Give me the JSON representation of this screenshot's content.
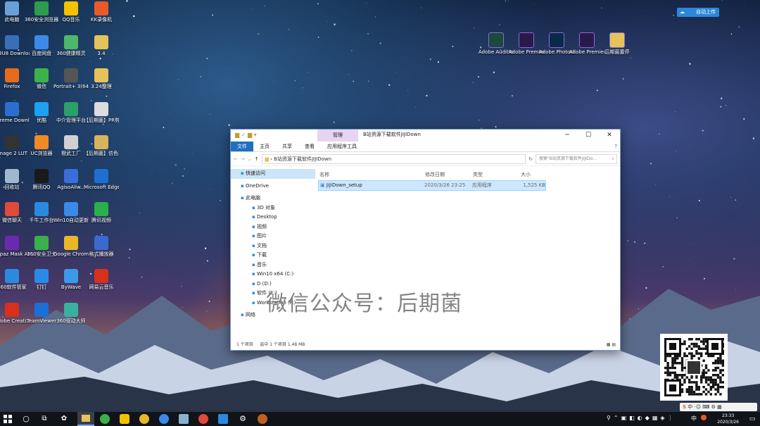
{
  "desktop_icons_left": [
    {
      "label": "此电脑",
      "icon": "computer-icon",
      "color": "#6aa0d8"
    },
    {
      "label": "360安全浏览器",
      "icon": "browser-360-icon",
      "color": "#2e9b4f"
    },
    {
      "label": "QQ音乐",
      "icon": "qq-music-icon",
      "color": "#f2c200"
    },
    {
      "label": "KK录像机",
      "icon": "kk-recorder-icon",
      "color": "#e85a2a"
    },
    {
      "label": "M3U8 Downloader",
      "icon": "m3u8-icon",
      "color": "#3a6fb8"
    },
    {
      "label": "百度网盘",
      "icon": "baidu-netdisk-icon",
      "color": "#3b8ae8"
    },
    {
      "label": "360健康精灵",
      "icon": "health-icon",
      "color": "#4db86a"
    },
    {
      "label": "3.4",
      "icon": "folder-icon",
      "color": "#e6c25a"
    },
    {
      "label": "Firefox",
      "icon": "firefox-icon",
      "color": "#e86a1c"
    },
    {
      "label": "微信",
      "icon": "wechat-icon",
      "color": "#3cb34a"
    },
    {
      "label": "Portrait+ 3(64 Bit)",
      "icon": "portrait-icon",
      "color": "#555555"
    },
    {
      "label": "3.24整理",
      "icon": "folder-icon",
      "color": "#e6c25a"
    },
    {
      "label": "Xtreme Downlo...",
      "icon": "xtreme-icon",
      "color": "#2a6fd0"
    },
    {
      "label": "优酷",
      "icon": "youku-icon",
      "color": "#1da1f2"
    },
    {
      "label": "中介管理平台",
      "icon": "platform-icon",
      "color": "#2aa06a"
    },
    {
      "label": "【后期菌】PR剪辑神...",
      "icon": "file-icon",
      "color": "#dddddd"
    },
    {
      "label": "Image 2 LUT",
      "icon": "image2lut-icon",
      "color": "#333333"
    },
    {
      "label": "UC浏览器",
      "icon": "uc-browser-icon",
      "color": "#f08a24"
    },
    {
      "label": "橙武工厂",
      "icon": "factory-icon",
      "color": "#d0d0d0"
    },
    {
      "label": "【后期菌】仿色神器软件...",
      "icon": "file-icon",
      "color": "#d8b45a"
    },
    {
      "label": "回收站",
      "icon": "recycle-bin-icon",
      "color": "#9fb8d0"
    },
    {
      "label": "腾讯QQ",
      "icon": "qq-icon",
      "color": "#1a1a1a"
    },
    {
      "label": "AgisoAliw...",
      "icon": "agiso-icon",
      "color": "#3a6fd8"
    },
    {
      "label": "Microsoft Edge",
      "icon": "edge-icon",
      "color": "#1e6fd0"
    },
    {
      "label": "微信聊天",
      "icon": "chat-icon",
      "color": "#e04a3a"
    },
    {
      "label": "千牛工作台",
      "icon": "qianniu-icon",
      "color": "#2a8ae0"
    },
    {
      "label": "Win10自动更新",
      "icon": "win10-update-icon",
      "color": "#3a8ae8"
    },
    {
      "label": "腾讯视频",
      "icon": "tencent-video-icon",
      "color": "#2ab04a"
    },
    {
      "label": "Topaz Mask AI",
      "icon": "topaz-icon",
      "color": "#6a2ab0"
    },
    {
      "label": "360安全卫士",
      "icon": "360-guard-icon",
      "color": "#3ab04a"
    },
    {
      "label": "Google Chrome",
      "icon": "chrome-icon",
      "color": "#e8b82a"
    },
    {
      "label": "格式播放器",
      "icon": "player-icon",
      "color": "#3a6ad0"
    },
    {
      "label": "360软件管家",
      "icon": "360-software-icon",
      "color": "#2a8ae0"
    },
    {
      "label": "钉钉",
      "icon": "dingtalk-icon",
      "color": "#2a8ae8"
    },
    {
      "label": "ByWave",
      "icon": "bywave-icon",
      "color": "#3a9ae8"
    },
    {
      "label": "网易云音乐",
      "icon": "netease-music-icon",
      "color": "#d8301a"
    },
    {
      "label": "Adobe Creati...",
      "icon": "adobe-cc-icon",
      "color": "#d8301a"
    },
    {
      "label": "TeamViewer",
      "icon": "teamviewer-icon",
      "color": "#1a6fd8"
    },
    {
      "label": "360驱动大师",
      "icon": "360-driver-icon",
      "color": "#3ab0a0"
    }
  ],
  "desktop_icons_right": [
    {
      "label": "Adobe Audition ...",
      "icon": "audition-icon",
      "color": "#1a4a3a"
    },
    {
      "label": "Adobe Premiere P...",
      "icon": "premiere-icon",
      "color": "#2a1a4a"
    },
    {
      "label": "Adobe Photosh...",
      "icon": "photoshop-icon",
      "color": "#0a2a4a"
    },
    {
      "label": "Adobe Premiere P...",
      "icon": "premiere-icon",
      "color": "#2a1a4a"
    },
    {
      "label": "后期菌置停",
      "icon": "file-icon",
      "color": "#e6c25a"
    }
  ],
  "baidu_upload": {
    "label": "自动上传"
  },
  "window": {
    "title": "B站资源下载软件JIJIDown",
    "context_tab": "管理",
    "controls": {
      "minimize": "─",
      "maximize": "☐",
      "close": "✕"
    },
    "ribbon_tabs": [
      "文件",
      "主页",
      "共享",
      "查看",
      "应用程序工具"
    ],
    "address_path": "B站资源下载软件JIJIDown",
    "search_placeholder": "搜索\"B站资源下载软件JIJIDo...",
    "nav_items": [
      {
        "label": "快速访问",
        "sub": false,
        "selected": true
      },
      {
        "label": "OneDrive",
        "sub": false,
        "selected": false
      },
      {
        "label": "此电脑",
        "sub": false,
        "selected": false
      },
      {
        "label": "3D 对象",
        "sub": true,
        "selected": false
      },
      {
        "label": "Desktop",
        "sub": true,
        "selected": false
      },
      {
        "label": "视频",
        "sub": true,
        "selected": false
      },
      {
        "label": "图片",
        "sub": true,
        "selected": false
      },
      {
        "label": "文档",
        "sub": true,
        "selected": false
      },
      {
        "label": "下载",
        "sub": true,
        "selected": false
      },
      {
        "label": "音乐",
        "sub": true,
        "selected": false
      },
      {
        "label": "Win10 x64 (C:)",
        "sub": true,
        "selected": false
      },
      {
        "label": "D (D:)",
        "sub": true,
        "selected": false
      },
      {
        "label": "软件 (E:)",
        "sub": true,
        "selected": false
      },
      {
        "label": "Workstation (F:)",
        "sub": true,
        "selected": false
      },
      {
        "label": "网络",
        "sub": false,
        "selected": false
      }
    ],
    "columns": [
      "名称",
      "修改日期",
      "类型",
      "大小"
    ],
    "files": [
      {
        "name": "JiJiDown_setup",
        "modified": "2020/3/26 23:25",
        "type": "应用程序",
        "size": "1,525 KB"
      }
    ],
    "status": {
      "items": "1 个项目",
      "selected": "选中 1 个项目  1.48 MB"
    }
  },
  "watermark": "微信公众号：后期菌",
  "taskbar": {
    "time": "23:33",
    "date": "2020/3/26",
    "ime": "中"
  }
}
